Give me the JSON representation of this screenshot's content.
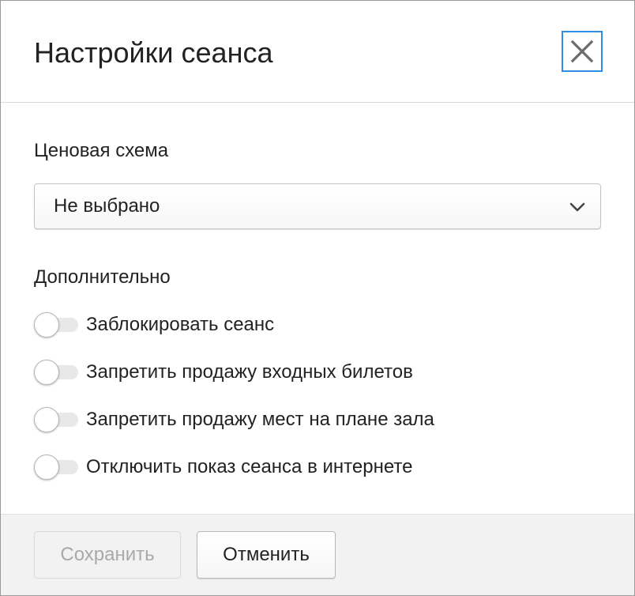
{
  "dialog": {
    "title": "Настройки сеанса",
    "close_icon": "close-icon"
  },
  "pricing": {
    "label": "Ценовая схема",
    "selected_value": "Не выбрано",
    "chevron_icon": "chevron-down-icon"
  },
  "extra": {
    "label": "Дополнительно",
    "toggles": [
      {
        "label": "Заблокировать сеанс",
        "on": false
      },
      {
        "label": "Запретить продажу входных билетов",
        "on": false
      },
      {
        "label": "Запретить продажу мест на плане зала",
        "on": false
      },
      {
        "label": "Отключить показ сеанса в интернете",
        "on": false
      }
    ]
  },
  "footer": {
    "save_label": "Сохранить",
    "save_disabled": true,
    "cancel_label": "Отменить"
  },
  "colors": {
    "focus_border": "#2f8de4",
    "text": "#222222",
    "disabled_text": "#a9a9a9",
    "footer_bg": "#f2f2f2"
  }
}
